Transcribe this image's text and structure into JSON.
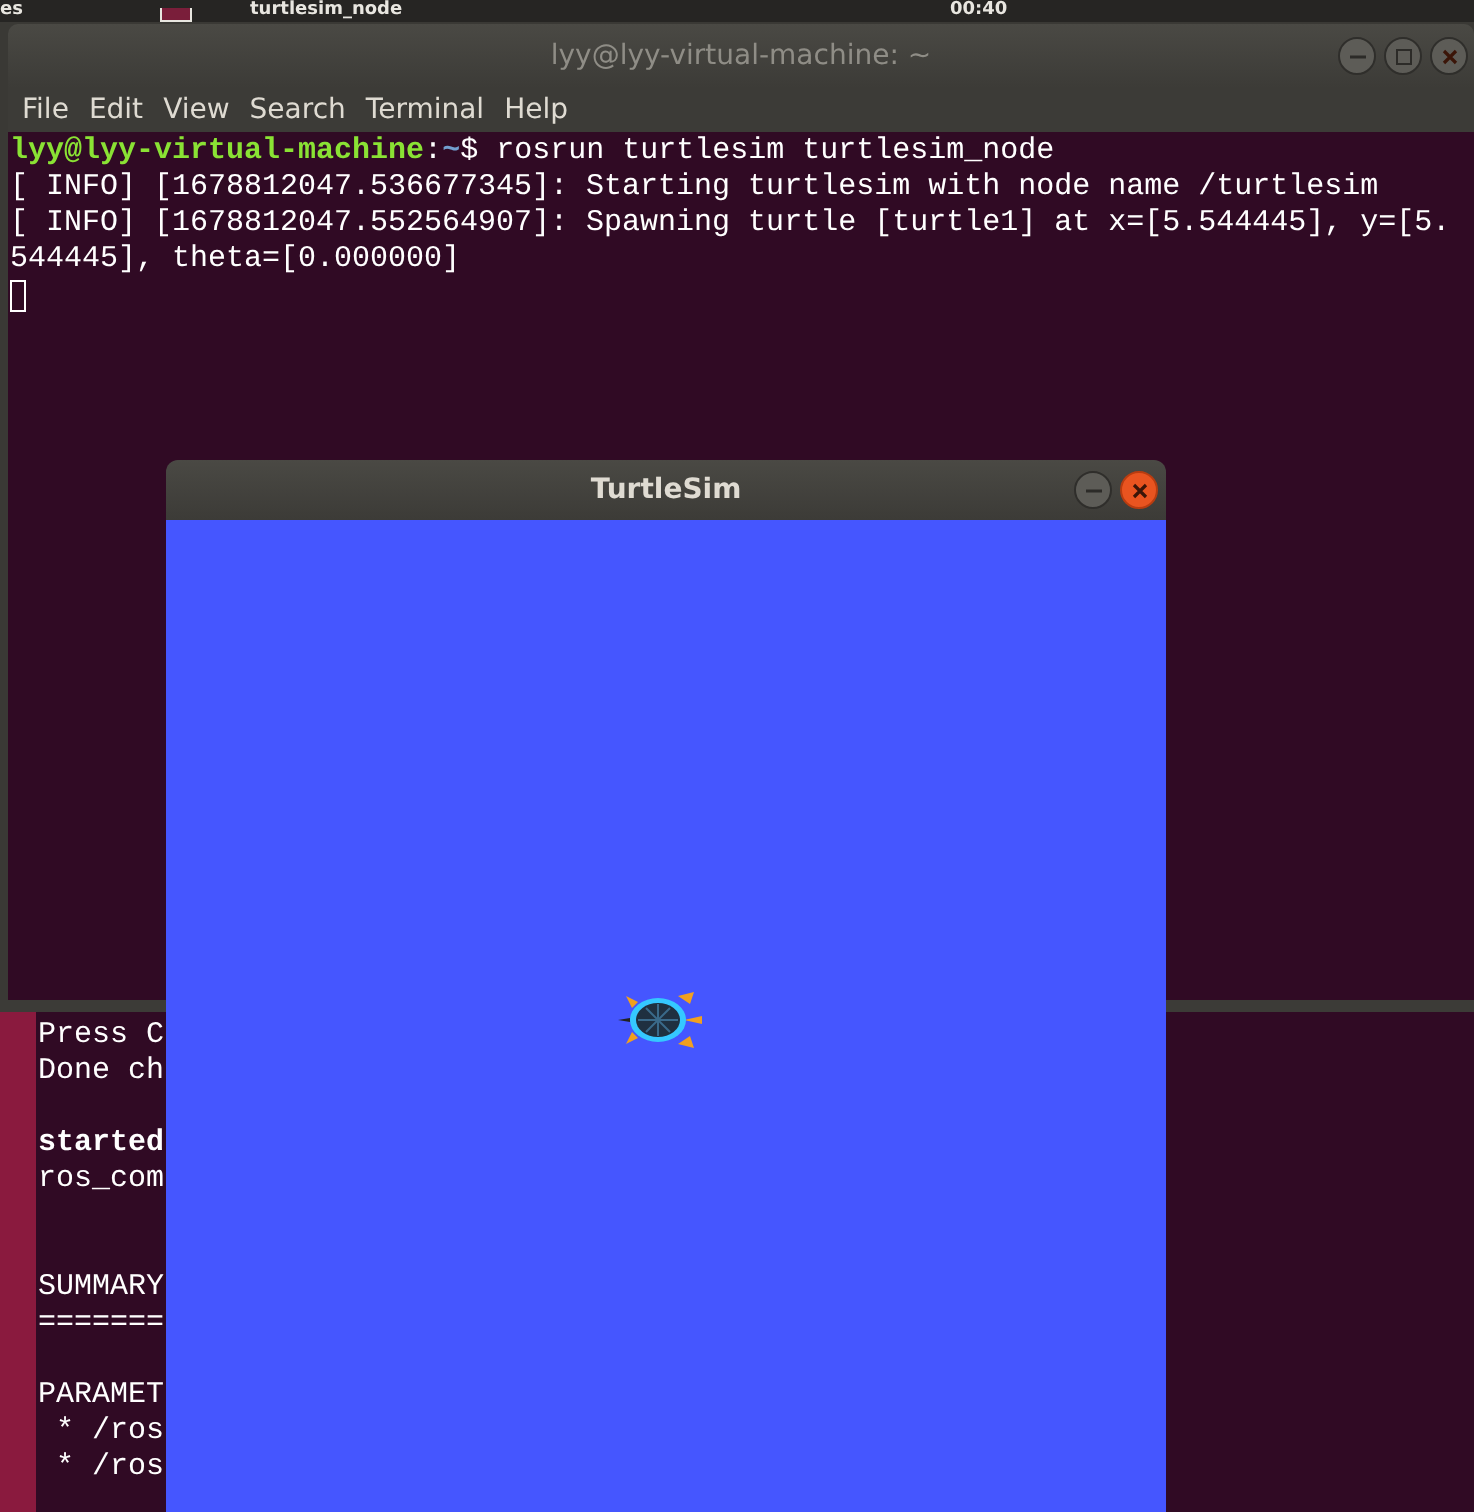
{
  "top_panel": {
    "app_menu": "es",
    "active_app": "turtlesim_node",
    "clock": "00:40"
  },
  "terminal": {
    "title": "lyy@lyy-virtual-machine: ~",
    "menu": [
      "File",
      "Edit",
      "View",
      "Search",
      "Terminal",
      "Help"
    ],
    "prompt": {
      "user_host": "lyy@lyy-virtual-machine",
      "separator": ":",
      "path": "~",
      "symbol": "$"
    },
    "command": "rosrun turtlesim turtlesim_node",
    "output": [
      "[ INFO] [1678812047.536677345]: Starting turtlesim with node name /turtlesim",
      "[ INFO] [1678812047.552564907]: Spawning turtle [turtle1] at x=[5.544445], y=[5.",
      "544445], theta=[0.000000]"
    ]
  },
  "background_terminal": {
    "lines": [
      {
        "kind": "text",
        "text": "Press C",
        "bold": false
      },
      {
        "kind": "text",
        "text": "Done ch",
        "bold": false
      },
      {
        "kind": "blank"
      },
      {
        "kind": "text",
        "text": "started",
        "bold": true
      },
      {
        "kind": "text",
        "text": "ros_com",
        "bold": false
      },
      {
        "kind": "blank"
      },
      {
        "kind": "blank"
      },
      {
        "kind": "text",
        "text": "SUMMARY",
        "bold": false
      },
      {
        "kind": "text",
        "text": "=======",
        "bold": false
      },
      {
        "kind": "blank"
      },
      {
        "kind": "text",
        "text": "PARAMET",
        "bold": false
      },
      {
        "kind": "text",
        "text": " * /ros",
        "bold": false
      },
      {
        "kind": "text",
        "text": " * /ros",
        "bold": false
      }
    ]
  },
  "turtlesim": {
    "title": "TurtleSim"
  }
}
